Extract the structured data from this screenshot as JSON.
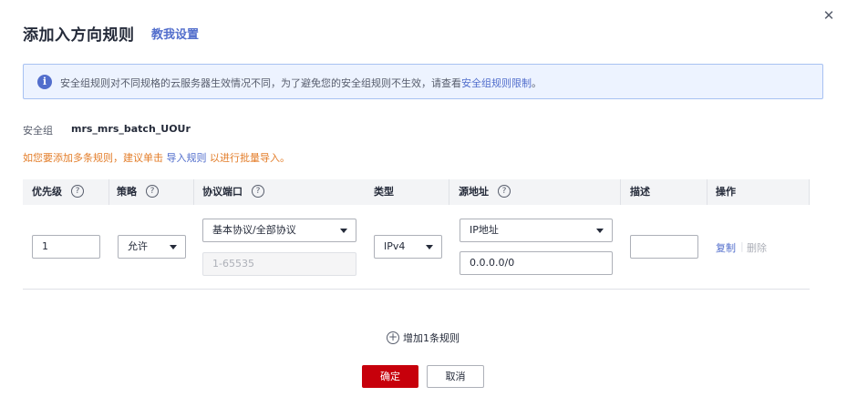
{
  "dialog": {
    "title": "添加入方向规则",
    "help_link": "教我设置",
    "close_glyph": "✕"
  },
  "notice": {
    "icon_glyph": "i",
    "text": "安全组规则对不同规格的云服务器生效情况不同，为了避免您的安全组规则不生效，请查看",
    "link": "安全组规则限制",
    "suffix": "。"
  },
  "security_group": {
    "label": "安全组",
    "value": "mrs_mrs_batch_UOUr"
  },
  "hint": {
    "prefix": "如您要添加多条规则，建议单击 ",
    "link": "导入规则",
    "suffix": " 以进行批量导入。"
  },
  "table": {
    "headers": {
      "priority": "优先级",
      "policy": "策略",
      "protocol_port": "协议端口",
      "type": "类型",
      "source": "源地址",
      "description": "描述",
      "actions": "操作"
    },
    "help_glyph": "?",
    "row": {
      "priority": "1",
      "policy": "允许",
      "protocol": "基本协议/全部协议",
      "port": "1-65535",
      "type": "IPv4",
      "source_type": "IP地址",
      "source_value": "0.0.0.0/0",
      "description": "",
      "copy": "复制",
      "separator": "|",
      "delete": "删除"
    }
  },
  "add_rule": {
    "glyph": "+",
    "label": "增加1条规则"
  },
  "footer": {
    "ok": "确定",
    "cancel": "取消"
  }
}
